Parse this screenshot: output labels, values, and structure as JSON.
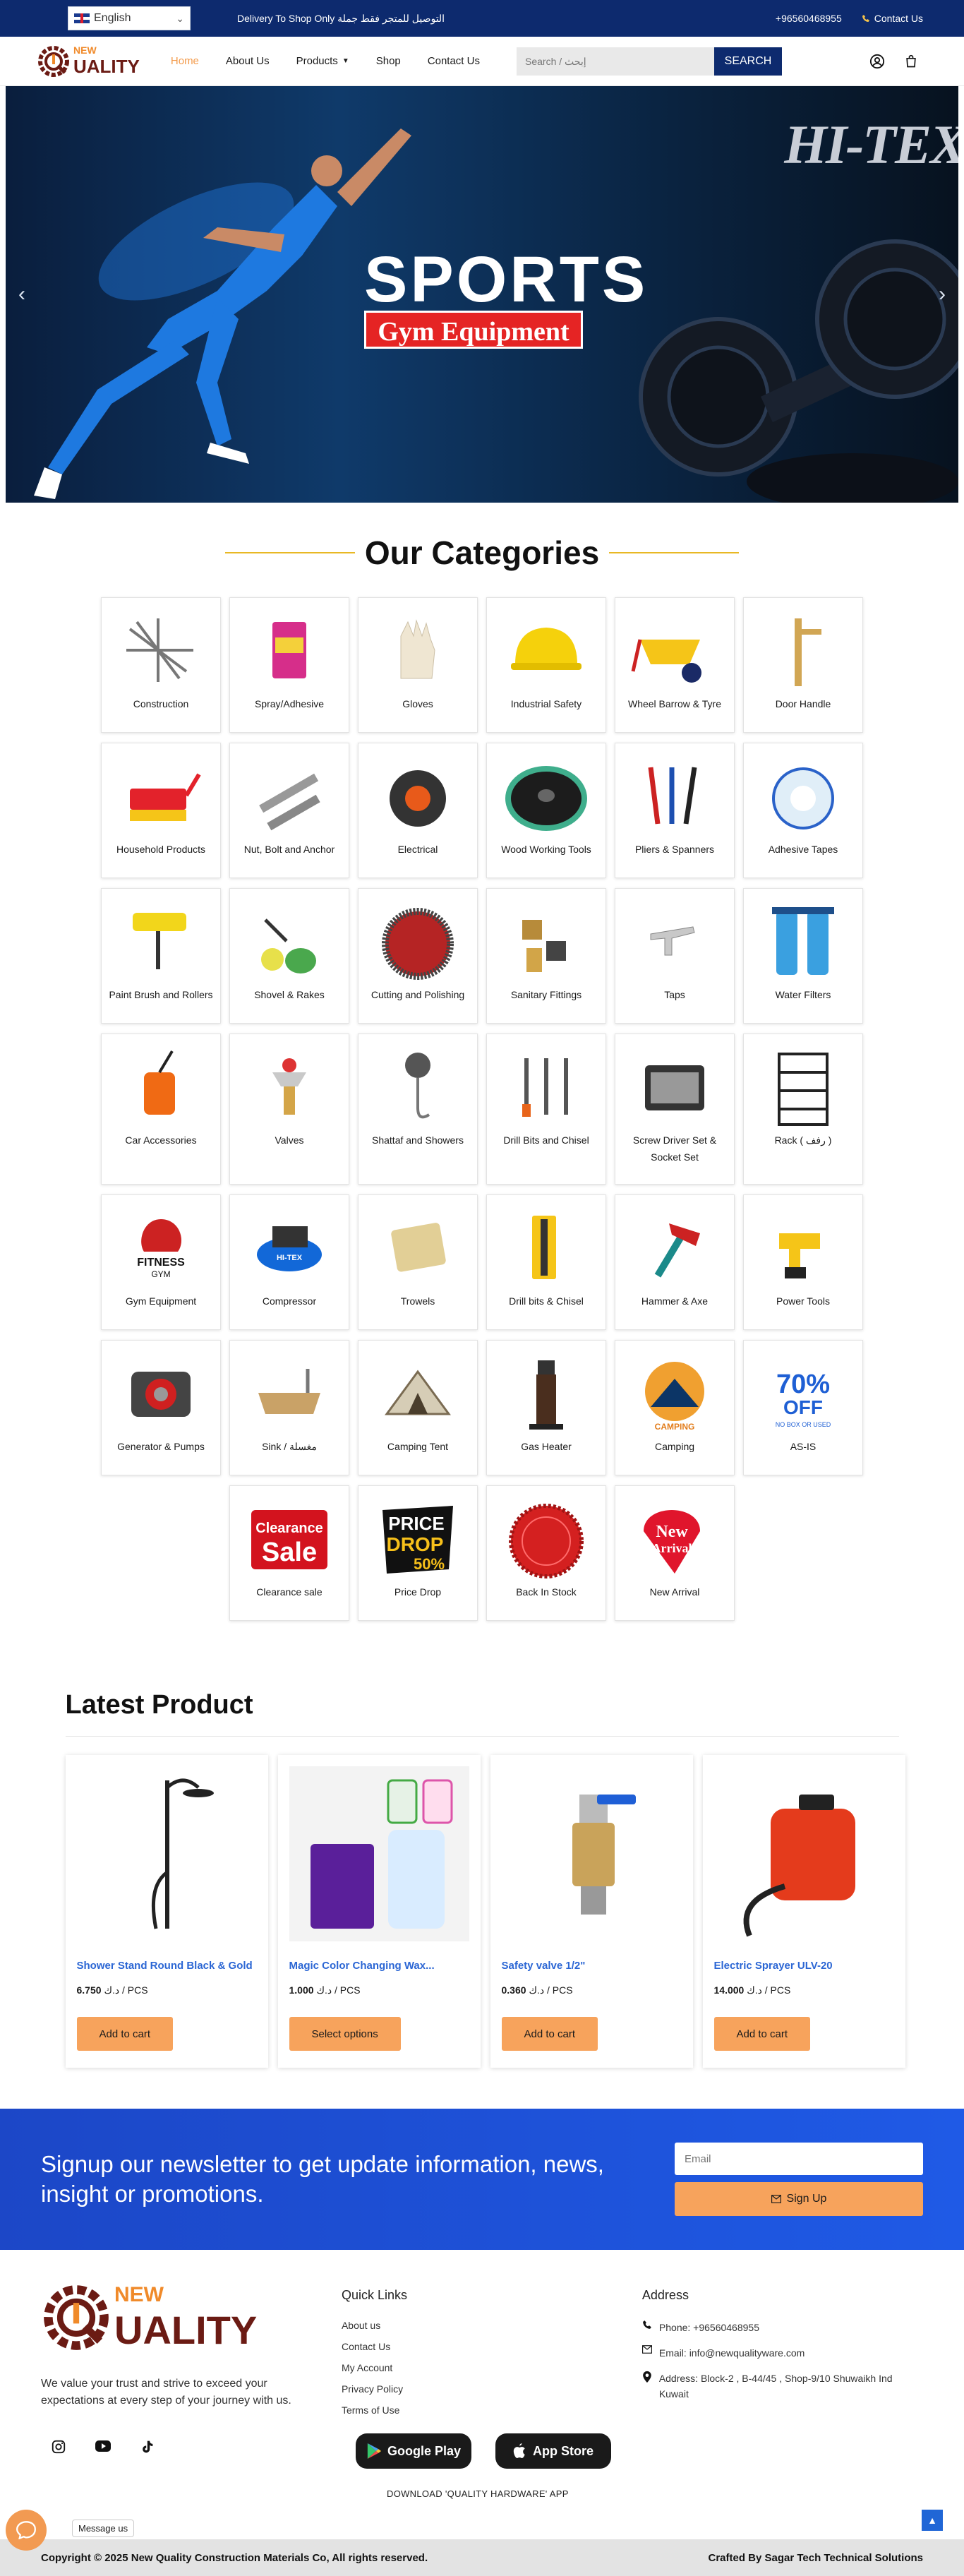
{
  "topbar": {
    "language": "English",
    "promo": "Delivery To Shop Only التوصيل للمتجر فقط جملة",
    "phone": "+96560468955",
    "contact": "Contact Us"
  },
  "header": {
    "logo_new": "NEW",
    "logo_quality": "UALITY",
    "nav": [
      {
        "label": "Home"
      },
      {
        "label": "About Us"
      },
      {
        "label": "Products"
      },
      {
        "label": "Shop"
      },
      {
        "label": "Contact Us"
      }
    ],
    "search_placeholder": "Search / إبحث",
    "search_button": "SEARCH"
  },
  "hero": {
    "brand": "HI-TEX",
    "title": "SPORTS",
    "subtitle": "Gym Equipment",
    "prev": "‹",
    "next": "›"
  },
  "categories": {
    "title": "Our Categories",
    "items": [
      {
        "label": "Construction"
      },
      {
        "label": "Spray/Adhesive"
      },
      {
        "label": "Gloves"
      },
      {
        "label": "Industrial Safety"
      },
      {
        "label": "Wheel Barrow & Tyre"
      },
      {
        "label": "Door Handle"
      },
      {
        "label": "Household Products"
      },
      {
        "label": "Nut, Bolt and Anchor"
      },
      {
        "label": "Electrical"
      },
      {
        "label": "Wood Working Tools"
      },
      {
        "label": "Pliers & Spanners"
      },
      {
        "label": "Adhesive Tapes"
      },
      {
        "label": "Paint Brush and Rollers"
      },
      {
        "label": "Shovel & Rakes"
      },
      {
        "label": "Cutting and Polishing"
      },
      {
        "label": "Sanitary Fittings"
      },
      {
        "label": "Taps"
      },
      {
        "label": "Water Filters"
      },
      {
        "label": "Car Accessories"
      },
      {
        "label": "Valves"
      },
      {
        "label": "Shattaf and Showers"
      },
      {
        "label": "Drill Bits and Chisel"
      },
      {
        "label": "Screw Driver Set & Socket Set"
      },
      {
        "label": "Rack ( رفف )"
      },
      {
        "label": "Gym Equipment"
      },
      {
        "label": "Compressor"
      },
      {
        "label": "Trowels"
      },
      {
        "label": "Drill bits & Chisel"
      },
      {
        "label": "Hammer & Axe"
      },
      {
        "label": "Power Tools"
      },
      {
        "label": "Generator & Pumps"
      },
      {
        "label": "Sink / مغسلة"
      },
      {
        "label": "Camping Tent"
      },
      {
        "label": "Gas Heater"
      },
      {
        "label": "Camping"
      },
      {
        "label": "AS-IS"
      }
    ],
    "last_row": [
      {
        "label": "Clearance sale"
      },
      {
        "label": "Price Drop"
      },
      {
        "label": "Back In Stock"
      },
      {
        "label": "New Arrival"
      }
    ],
    "badges": {
      "fitness": "FITNESS",
      "gym": "GYM",
      "camping": "CAMPING",
      "off_pct": "70%",
      "off": "OFF",
      "no_box": "NO BOX OR USED",
      "clearance": "Clearance",
      "sale": "Sale",
      "price": "PRICE",
      "drop": "DROP",
      "drop_pct": "50%",
      "new": "New",
      "arrival": "Arrival",
      "hitex": "HI-TEX"
    }
  },
  "latest": {
    "title": "Latest Product",
    "products": [
      {
        "name": "Shower Stand Round Black & Gold",
        "currency": "د.ك",
        "price": "6.750",
        "unit": "/ PCS",
        "button": "Add to cart"
      },
      {
        "name": "Magic Color Changing Wax...",
        "currency": "د.ك",
        "price": "1.000",
        "unit": "/ PCS",
        "button": "Select options"
      },
      {
        "name": "Safety valve 1/2\"",
        "currency": "د.ك",
        "price": "0.360",
        "unit": "/ PCS",
        "button": "Add to cart"
      },
      {
        "name": "Electric Sprayer ULV-20",
        "currency": "د.ك",
        "price": "14.000",
        "unit": "/ PCS",
        "button": "Add to cart"
      }
    ]
  },
  "newsletter": {
    "text": "Signup our newsletter to get update information, news, insight or promotions.",
    "email_placeholder": "Email",
    "button": "Sign Up"
  },
  "footer": {
    "tagline": "We value your trust and strive to exceed your expectations at every step of your journey with us.",
    "quick_links_title": "Quick Links",
    "quick_links": [
      "About us",
      "Contact Us",
      "My Account",
      "Privacy Policy",
      "Terms of Use"
    ],
    "address_title": "Address",
    "phone": "Phone: +96560468955",
    "email": "Email: info@newqualityware.com",
    "address": "Address: Block-2 , B-44/45 , Shop-9/10 Shuwaikh Ind Kuwait",
    "google_play": "Google Play",
    "app_store": "App Store",
    "download": "DOWNLOAD 'QUALITY HARDWARE' APP",
    "message_us": "Message us",
    "copyright": "Copyright © 2025 New Quality Construction Materials Co, All rights reserved.",
    "crafted": "Crafted By Sagar Tech Technical Solutions"
  },
  "colors": {
    "navy": "#0d2a6e",
    "accent_orange": "#f7a35c",
    "link_blue": "#2b66d4",
    "newsletter_blue": "#1f5ae6",
    "gold_line": "#e8b824"
  }
}
